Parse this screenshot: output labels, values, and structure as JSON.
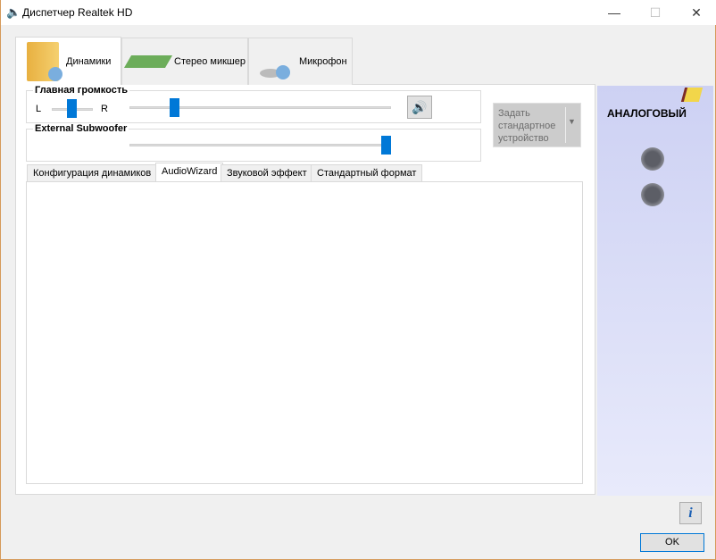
{
  "window": {
    "title": "Диспетчер Realtek HD",
    "min": "—",
    "max": "☐",
    "close": "✕"
  },
  "device_tabs": [
    {
      "label": "Динамики"
    },
    {
      "label": "Стерео микшер"
    },
    {
      "label": "Микрофон"
    }
  ],
  "main_volume": {
    "label": "Главная громкость",
    "left": "L",
    "right": "R",
    "balance": 0.5,
    "volume": 0.17
  },
  "subwoofer": {
    "label": "External Subwoofer",
    "volume": 1.0
  },
  "default_device": {
    "label": "Задать стандартное устройство"
  },
  "sub_tabs": [
    {
      "label": "Конфигурация динамиков"
    },
    {
      "label": "AudioWizard"
    },
    {
      "label": "Звуковой эффект"
    },
    {
      "label": "Стандартный формат"
    }
  ],
  "right_panel": {
    "title": "АНАЛОГОВЫЙ"
  },
  "ok_label": "OK"
}
